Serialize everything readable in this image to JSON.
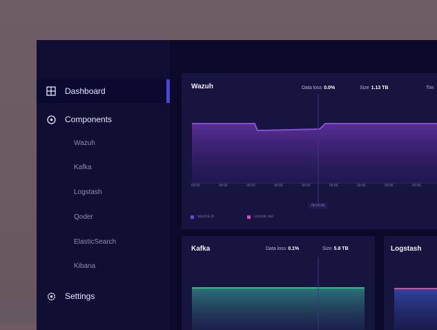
{
  "sidebar": {
    "items": [
      {
        "label": "Dashboard",
        "icon": "dashboard-icon"
      },
      {
        "label": "Components",
        "icon": "components-icon"
      },
      {
        "label": "Settings",
        "icon": "settings-icon"
      }
    ],
    "sub_items": [
      "Wazuh",
      "Kafka",
      "Logstash",
      "Qoder",
      "ElasticSearch",
      "Kibana"
    ]
  },
  "panels": {
    "wazuh": {
      "title": "Wazuh",
      "metric1_label": "Data loss",
      "metric1_value": "0.0%",
      "metric2_label": "Size",
      "metric2_value": "1.13 TB",
      "metric3_label": "Tim",
      "center_badge": "00:00:00",
      "legend": [
        "source in",
        "source out"
      ],
      "ticks": [
        "00:00",
        "00:00",
        "00:00",
        "00:00",
        "00:00",
        "00:00",
        "00:00",
        "00:00",
        "00:00"
      ]
    },
    "kafka": {
      "title": "Kafka",
      "metric1_label": "Data loss",
      "metric1_value": "0.1%",
      "metric2_label": "Size",
      "metric2_value": "5.8 TB"
    },
    "logstash": {
      "title": "Logstash"
    }
  },
  "colors": {
    "accent": "#4c47d8",
    "wazuh_line": "#7d4ec8",
    "kafka_line": "#3cb68a",
    "logstash_line": "#e0488f"
  }
}
